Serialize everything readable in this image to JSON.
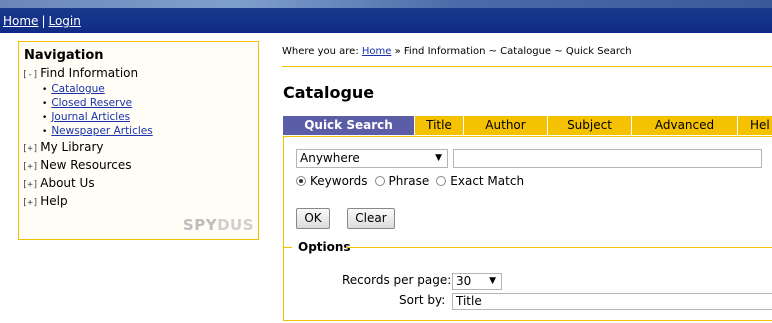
{
  "header": {
    "home_link": "Home",
    "separator": "|",
    "login_link": "Login"
  },
  "nav": {
    "title": "Navigation",
    "groups": [
      {
        "toggle": "[-]",
        "label": "Find Information",
        "items": [
          "Catalogue",
          "Closed Reserve",
          "Journal Articles",
          "Newspaper Articles"
        ]
      },
      {
        "toggle": "[+]",
        "label": "My Library"
      },
      {
        "toggle": "[+]",
        "label": "New Resources"
      },
      {
        "toggle": "[+]",
        "label": "About Us"
      },
      {
        "toggle": "[+]",
        "label": "Help"
      }
    ],
    "logo_text": "SPYDUS",
    "logo_a": "SPY",
    "logo_b": "DUS"
  },
  "breadcrumb": {
    "prefix": "Where you are:",
    "home": "Home",
    "rest": " » Find Information ~ Catalogue ~ Quick Search"
  },
  "page_title": "Catalogue",
  "tabs": [
    "Quick Search",
    "Title",
    "Author",
    "Subject",
    "Advanced",
    "Hel"
  ],
  "active_tab": "Quick Search",
  "search": {
    "field_select": "Anywhere",
    "query_value": "",
    "radio_options": [
      "Keywords",
      "Phrase",
      "Exact Match"
    ],
    "selected_radio": "Keywords",
    "ok_label": "OK",
    "clear_label": "Clear"
  },
  "options": {
    "title": "Options",
    "records_label": "Records per page:",
    "records_value": "30",
    "sort_label": "Sort by:",
    "sort_value": "Title"
  },
  "colors": {
    "accent": "#f4c200",
    "active_tab": "#5b5ea6",
    "header": "#0f2a86",
    "link": "#1a33aa"
  }
}
